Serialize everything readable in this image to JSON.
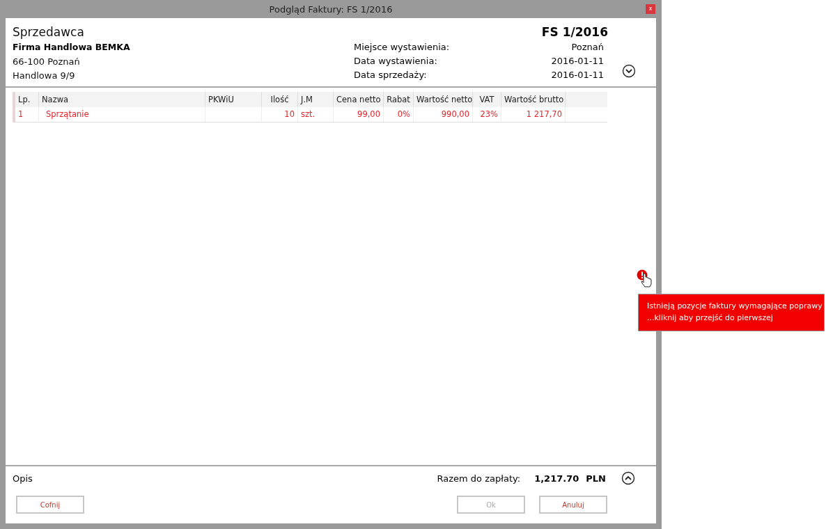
{
  "window": {
    "title": "Podgląd Faktury: FS 1/2016",
    "close": "x"
  },
  "seller": {
    "heading": "Sprzedawca",
    "name": "Firma Handlowa BEMKA",
    "lines": [
      "66-100 Poznań",
      "Handlowa 9/9"
    ]
  },
  "invoice": {
    "number": "FS 1/2016",
    "fields": [
      {
        "label": "Miejsce wystawienia:",
        "value": "Poznań"
      },
      {
        "label": "Data wystawienia:",
        "value": "2016-01-11"
      },
      {
        "label": "Data sprzedaży:",
        "value": "2016-01-11"
      }
    ],
    "expanded": false
  },
  "table": {
    "columns": [
      "Lp.",
      "Nazwa",
      "PKWiU",
      "Ilość",
      "J.M",
      "Cena netto",
      "Rabat",
      "Wartość netto",
      "VAT",
      "Wartość brutto"
    ],
    "rows": [
      {
        "error": true,
        "cells": [
          "1",
          "Sprzątanie",
          "",
          "10",
          "szt.",
          "99,00",
          "0%",
          "990,00",
          "23%",
          "1 217,70"
        ]
      }
    ]
  },
  "warning": {
    "lines": [
      "Istnieją pozycje faktury wymagające poprawy",
      "...kliknij aby przejść do pierwszej"
    ]
  },
  "footer": {
    "description_label": "Opis",
    "total_label": "Razem do zapłaty:",
    "total": "1,217.70",
    "currency": "PLN",
    "expanded": false
  },
  "buttons": [
    {
      "label": "Cofnij",
      "disabled": false,
      "kind": "left"
    },
    {
      "label": "Ok",
      "disabled": true,
      "kind": "right"
    },
    {
      "label": "Anuluj",
      "disabled": false,
      "kind": "right"
    }
  ]
}
